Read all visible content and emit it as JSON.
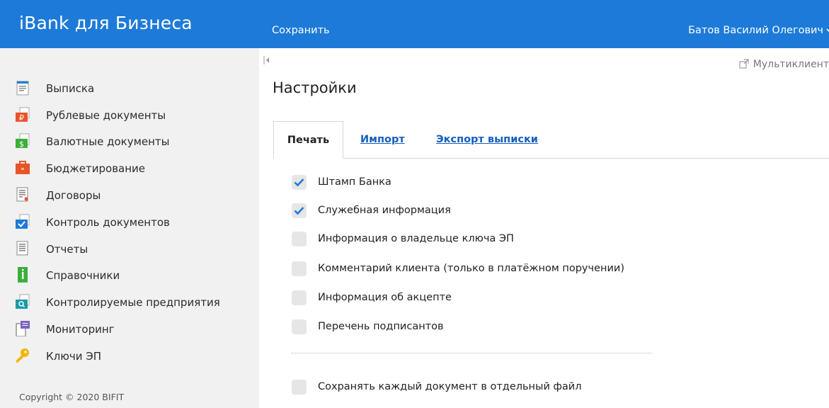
{
  "app": {
    "title": "iBank для Бизнеса"
  },
  "header": {
    "save_label": "Сохранить",
    "user_name": "Батов Василий Олегович",
    "user_chevron": "chevron-down-icon"
  },
  "sidebar": {
    "items": [
      {
        "label": "Выписка",
        "icon": "statement-icon"
      },
      {
        "label": "Рублевые документы",
        "icon": "ruble-documents-icon"
      },
      {
        "label": "Валютные документы",
        "icon": "currency-documents-icon"
      },
      {
        "label": "Бюджетирование",
        "icon": "budget-briefcase-icon"
      },
      {
        "label": "Договоры",
        "icon": "contracts-icon"
      },
      {
        "label": "Контроль документов",
        "icon": "document-control-icon"
      },
      {
        "label": "Отчеты",
        "icon": "reports-icon"
      },
      {
        "label": "Справочники",
        "icon": "reference-info-icon"
      },
      {
        "label": "Контролируемые предприятия",
        "icon": "controlled-enterprises-icon"
      },
      {
        "label": "Мониторинг",
        "icon": "monitoring-icon"
      },
      {
        "label": "Ключи ЭП",
        "icon": "key-icon"
      }
    ],
    "copyright": "Copyright © 2020 BIFIT"
  },
  "main": {
    "multiclient_label": "Мультиклиент",
    "title": "Настройки",
    "tabs": [
      {
        "label": "Печать",
        "active": true
      },
      {
        "label": "Импорт",
        "active": false
      },
      {
        "label": "Экспорт выписки",
        "active": false
      }
    ],
    "options": [
      {
        "label": "Штамп Банка",
        "checked": true
      },
      {
        "label": "Служебная информация",
        "checked": true
      },
      {
        "label": "Информация о владельце ключа ЭП",
        "checked": false
      },
      {
        "label": "Комментарий клиента (только в платёжном поручении)",
        "checked": false
      },
      {
        "label": "Информация об акцепте",
        "checked": false
      },
      {
        "label": "Перечень подписантов",
        "checked": false
      }
    ],
    "separate_file_option": {
      "label": "Сохранять каждый документ в отдельный файл",
      "checked": false
    }
  },
  "colors": {
    "brand_blue": "#1d7ad8",
    "link_blue": "#1560bd",
    "sidebar_bg": "#f1f1f1",
    "check_blue": "#1d7ad8"
  }
}
